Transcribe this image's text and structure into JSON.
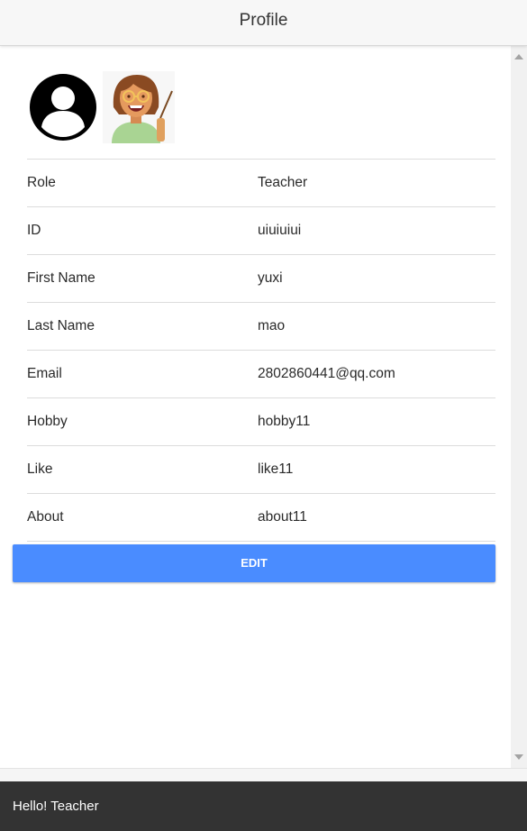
{
  "header": {
    "title": "Profile"
  },
  "avatars": {
    "default_icon": "user-avatar-icon",
    "role_icon": "teacher-avatar-icon"
  },
  "profile": {
    "rows": [
      {
        "label": "Role",
        "value": "Teacher"
      },
      {
        "label": "ID",
        "value": "uiuiuiui"
      },
      {
        "label": "First Name",
        "value": "yuxi"
      },
      {
        "label": "Last Name",
        "value": "mao"
      },
      {
        "label": "Email",
        "value": "2802860441@qq.com"
      },
      {
        "label": "Hobby",
        "value": "hobby11"
      },
      {
        "label": "Like",
        "value": "like11"
      },
      {
        "label": "About",
        "value": "about11"
      }
    ]
  },
  "actions": {
    "edit_label": "EDIT"
  },
  "footer": {
    "greeting": "Hello! Teacher"
  },
  "colors": {
    "accent": "#4a8cff",
    "footer_bg": "#333333",
    "header_bg": "#f7f7f7"
  }
}
